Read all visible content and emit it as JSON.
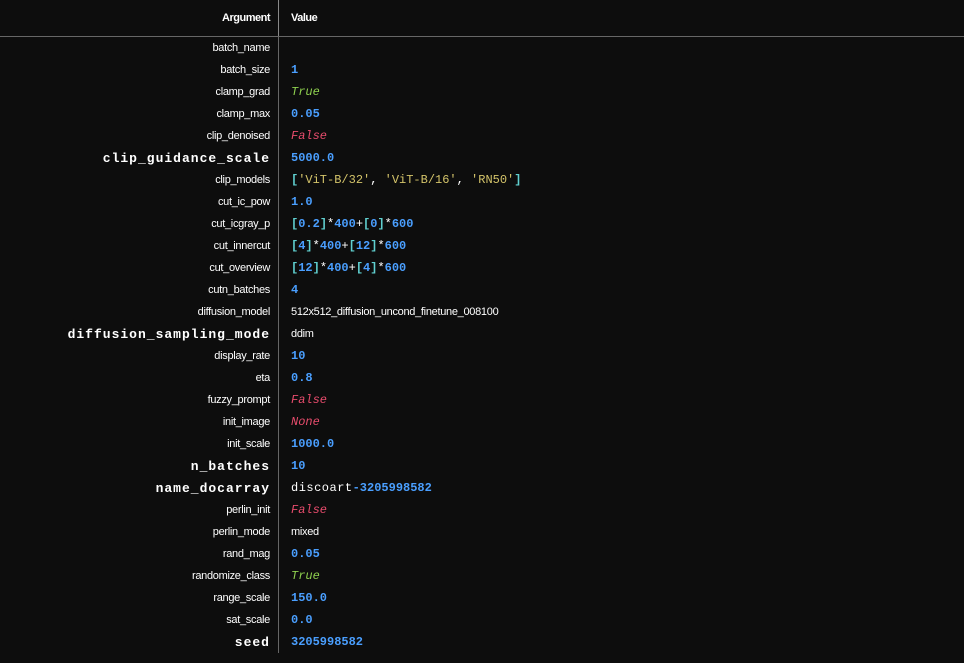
{
  "header": {
    "argument": "Argument",
    "value": "Value"
  },
  "rows": [
    {
      "argument": "batch_name",
      "bold": false,
      "segments": []
    },
    {
      "argument": "batch_size",
      "bold": false,
      "segments": [
        {
          "text": "1",
          "cls": "c-blue"
        }
      ]
    },
    {
      "argument": "clamp_grad",
      "bold": false,
      "segments": [
        {
          "text": "True",
          "cls": "c-green-italic"
        }
      ]
    },
    {
      "argument": "clamp_max",
      "bold": false,
      "segments": [
        {
          "text": "0.05",
          "cls": "c-blue"
        }
      ]
    },
    {
      "argument": "clip_denoised",
      "bold": false,
      "segments": [
        {
          "text": "False",
          "cls": "c-red-italic"
        }
      ]
    },
    {
      "argument": "clip_guidance_scale",
      "bold": true,
      "segments": [
        {
          "text": "5000.0",
          "cls": "c-blue"
        }
      ]
    },
    {
      "argument": "clip_models",
      "bold": false,
      "segments": [
        {
          "text": "[",
          "cls": "c-cyan-bold"
        },
        {
          "text": "'ViT-B/32'",
          "cls": "c-yellow"
        },
        {
          "text": ", ",
          "cls": "c-white"
        },
        {
          "text": "'ViT-B/16'",
          "cls": "c-yellow"
        },
        {
          "text": ", ",
          "cls": "c-white"
        },
        {
          "text": "'RN50'",
          "cls": "c-yellow"
        },
        {
          "text": "]",
          "cls": "c-cyan-bold"
        }
      ]
    },
    {
      "argument": "cut_ic_pow",
      "bold": false,
      "segments": [
        {
          "text": "1.0",
          "cls": "c-blue"
        }
      ]
    },
    {
      "argument": "cut_icgray_p",
      "bold": false,
      "segments": [
        {
          "text": "[",
          "cls": "c-cyan-bold"
        },
        {
          "text": "0.2",
          "cls": "c-blue"
        },
        {
          "text": "]",
          "cls": "c-cyan-bold"
        },
        {
          "text": "*",
          "cls": "c-white"
        },
        {
          "text": "400",
          "cls": "c-blue"
        },
        {
          "text": "+",
          "cls": "c-white"
        },
        {
          "text": "[",
          "cls": "c-cyan-bold"
        },
        {
          "text": "0",
          "cls": "c-blue"
        },
        {
          "text": "]",
          "cls": "c-cyan-bold"
        },
        {
          "text": "*",
          "cls": "c-white"
        },
        {
          "text": "600",
          "cls": "c-blue"
        }
      ]
    },
    {
      "argument": "cut_innercut",
      "bold": false,
      "segments": [
        {
          "text": "[",
          "cls": "c-cyan-bold"
        },
        {
          "text": "4",
          "cls": "c-blue"
        },
        {
          "text": "]",
          "cls": "c-cyan-bold"
        },
        {
          "text": "*",
          "cls": "c-white"
        },
        {
          "text": "400",
          "cls": "c-blue"
        },
        {
          "text": "+",
          "cls": "c-white"
        },
        {
          "text": "[",
          "cls": "c-cyan-bold"
        },
        {
          "text": "12",
          "cls": "c-blue"
        },
        {
          "text": "]",
          "cls": "c-cyan-bold"
        },
        {
          "text": "*",
          "cls": "c-white"
        },
        {
          "text": "600",
          "cls": "c-blue"
        }
      ]
    },
    {
      "argument": "cut_overview",
      "bold": false,
      "segments": [
        {
          "text": "[",
          "cls": "c-cyan-bold"
        },
        {
          "text": "12",
          "cls": "c-blue"
        },
        {
          "text": "]",
          "cls": "c-cyan-bold"
        },
        {
          "text": "*",
          "cls": "c-white"
        },
        {
          "text": "400",
          "cls": "c-blue"
        },
        {
          "text": "+",
          "cls": "c-white"
        },
        {
          "text": "[",
          "cls": "c-cyan-bold"
        },
        {
          "text": "4",
          "cls": "c-blue"
        },
        {
          "text": "]",
          "cls": "c-cyan-bold"
        },
        {
          "text": "*",
          "cls": "c-white"
        },
        {
          "text": "600",
          "cls": "c-blue"
        }
      ]
    },
    {
      "argument": "cutn_batches",
      "bold": false,
      "segments": [
        {
          "text": "4",
          "cls": "c-blue"
        }
      ]
    },
    {
      "argument": "diffusion_model",
      "bold": false,
      "segments": [
        {
          "text": "512x512_diffusion_uncond_finetune_008100",
          "cls": "c-white cond"
        }
      ]
    },
    {
      "argument": "diffusion_sampling_mode",
      "bold": true,
      "segments": [
        {
          "text": "ddim",
          "cls": "c-white cond"
        }
      ]
    },
    {
      "argument": "display_rate",
      "bold": false,
      "segments": [
        {
          "text": "10",
          "cls": "c-blue"
        }
      ]
    },
    {
      "argument": "eta",
      "bold": false,
      "segments": [
        {
          "text": "0.8",
          "cls": "c-blue"
        }
      ]
    },
    {
      "argument": "fuzzy_prompt",
      "bold": false,
      "segments": [
        {
          "text": "False",
          "cls": "c-red-italic"
        }
      ]
    },
    {
      "argument": "init_image",
      "bold": false,
      "segments": [
        {
          "text": "None",
          "cls": "c-red-italic"
        }
      ]
    },
    {
      "argument": "init_scale",
      "bold": false,
      "segments": [
        {
          "text": "1000.0",
          "cls": "c-blue"
        }
      ]
    },
    {
      "argument": "n_batches",
      "bold": true,
      "segments": [
        {
          "text": "10",
          "cls": "c-blue"
        }
      ]
    },
    {
      "argument": "name_docarray",
      "bold": true,
      "segments": [
        {
          "text": "discoart",
          "cls": "c-white argspace"
        },
        {
          "text": "-3205998582",
          "cls": "c-blue"
        }
      ]
    },
    {
      "argument": "perlin_init",
      "bold": false,
      "segments": [
        {
          "text": "False",
          "cls": "c-red-italic"
        }
      ]
    },
    {
      "argument": "perlin_mode",
      "bold": false,
      "segments": [
        {
          "text": "mixed",
          "cls": "c-white cond"
        }
      ]
    },
    {
      "argument": "rand_mag",
      "bold": false,
      "segments": [
        {
          "text": "0.05",
          "cls": "c-blue"
        }
      ]
    },
    {
      "argument": "randomize_class",
      "bold": false,
      "segments": [
        {
          "text": "True",
          "cls": "c-green-italic"
        }
      ]
    },
    {
      "argument": "range_scale",
      "bold": false,
      "segments": [
        {
          "text": "150.0",
          "cls": "c-blue"
        }
      ]
    },
    {
      "argument": "sat_scale",
      "bold": false,
      "segments": [
        {
          "text": "0.0",
          "cls": "c-blue"
        }
      ]
    },
    {
      "argument": "seed",
      "bold": true,
      "segments": [
        {
          "text": "3205998582",
          "cls": "c-blue"
        }
      ]
    }
  ]
}
